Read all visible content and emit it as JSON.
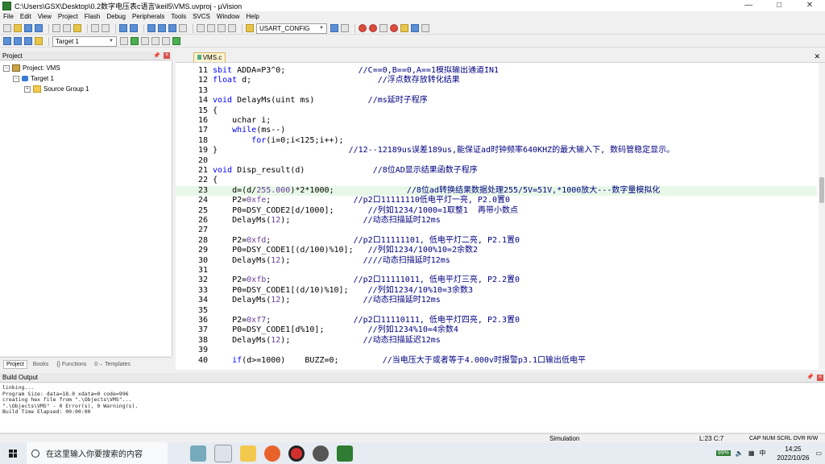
{
  "window": {
    "title": "C:\\Users\\GSX\\Desktop\\0.2数字电压表c语言\\keil5\\VMS.uvproj - µVision",
    "controls": [
      "—",
      "□",
      "✕"
    ]
  },
  "menu": [
    "File",
    "Edit",
    "View",
    "Project",
    "Flash",
    "Debug",
    "Peripherals",
    "Tools",
    "SVCS",
    "Window",
    "Help"
  ],
  "toolbar": {
    "config_combo": "USART_CONFIG",
    "target_combo": "Target 1"
  },
  "project_pane": {
    "title": "Project",
    "items": [
      {
        "label": "Project: VMS"
      },
      {
        "label": "Target 1"
      },
      {
        "label": "Source Group 1"
      }
    ],
    "tabs": [
      "Project",
      "Books",
      "{} Functions",
      "0→ Templates"
    ]
  },
  "editor": {
    "tab": "VMS.c",
    "current_line": 23
  },
  "code_lines": [
    {
      "n": "11",
      "parts": [
        [
          "kw",
          "sbit"
        ],
        [
          "t",
          " ADDA=P3^0;               "
        ],
        [
          "cm",
          "//C==0,B==0,A==1模拟输出通道IN1"
        ]
      ]
    },
    {
      "n": "12",
      "parts": [
        [
          "kw",
          "float"
        ],
        [
          "t",
          " d;                          "
        ],
        [
          "cm",
          "//浮点数存放转化结果"
        ]
      ]
    },
    {
      "n": "13",
      "parts": [
        [
          "t",
          ""
        ]
      ]
    },
    {
      "n": "14",
      "parts": [
        [
          "kw",
          "void"
        ],
        [
          "t",
          " DelayMs(uint ms)           "
        ],
        [
          "cm",
          "//ms延时子程序"
        ]
      ]
    },
    {
      "n": "15",
      "parts": [
        [
          "t",
          "{"
        ]
      ]
    },
    {
      "n": "16",
      "parts": [
        [
          "t",
          "    uchar i;"
        ]
      ]
    },
    {
      "n": "17",
      "parts": [
        [
          "t",
          "    "
        ],
        [
          "kw",
          "while"
        ],
        [
          "t",
          "(ms--)"
        ]
      ]
    },
    {
      "n": "18",
      "parts": [
        [
          "t",
          "        "
        ],
        [
          "kw",
          "for"
        ],
        [
          "t",
          "(i=0;i<125;i++);"
        ]
      ]
    },
    {
      "n": "19",
      "parts": [
        [
          "t",
          "}                           "
        ],
        [
          "cm",
          "//12--12189us误差189us,能保证ad时钟频率640KHZ的最大输入下, 数码管稳定显示。"
        ]
      ]
    },
    {
      "n": "20",
      "parts": [
        [
          "t",
          ""
        ]
      ]
    },
    {
      "n": "21",
      "parts": [
        [
          "kw",
          "void"
        ],
        [
          "t",
          " Disp_result(d)              "
        ],
        [
          "cm",
          "//8位AD显示结果函数子程序"
        ]
      ]
    },
    {
      "n": "22",
      "parts": [
        [
          "t",
          "{"
        ]
      ]
    },
    {
      "n": "23",
      "parts": [
        [
          "t",
          "    d=(d/"
        ],
        [
          "num",
          "255.000"
        ],
        [
          "t",
          ")*2*1000;               "
        ],
        [
          "cm",
          "//8位ad转换结果数据处理255/5V=51V,*1000放大---数字量模拟化"
        ]
      ]
    },
    {
      "n": "24",
      "parts": [
        [
          "t",
          "    P2="
        ],
        [
          "num",
          "0xfe"
        ],
        [
          "t",
          ";                 "
        ],
        [
          "cm",
          "//p2口11111110低电平灯一亮, P2.0置0"
        ]
      ]
    },
    {
      "n": "25",
      "parts": [
        [
          "t",
          "    P0=DSY_CODE2[d/1000];       "
        ],
        [
          "cm",
          "//列如1234/1000=1取整1  再带小数点"
        ]
      ]
    },
    {
      "n": "26",
      "parts": [
        [
          "t",
          "    DelayMs("
        ],
        [
          "num",
          "12"
        ],
        [
          "t",
          ");               "
        ],
        [
          "cm",
          "//动态扫描延时12ms"
        ]
      ]
    },
    {
      "n": "27",
      "parts": [
        [
          "t",
          ""
        ]
      ]
    },
    {
      "n": "28",
      "parts": [
        [
          "t",
          "    P2="
        ],
        [
          "num",
          "0xfd"
        ],
        [
          "t",
          ";                 "
        ],
        [
          "cm",
          "//p2口11111101, 低电平灯二亮, P2.1置0"
        ]
      ]
    },
    {
      "n": "29",
      "parts": [
        [
          "t",
          "    P0=DSY_CODE1[(d/100)%10];   "
        ],
        [
          "cm",
          "//列如1234/100%10=2余数2"
        ]
      ]
    },
    {
      "n": "30",
      "parts": [
        [
          "t",
          "    DelayMs("
        ],
        [
          "num",
          "12"
        ],
        [
          "t",
          ");               "
        ],
        [
          "cm",
          "////动态扫描延时12ms"
        ]
      ]
    },
    {
      "n": "31",
      "parts": [
        [
          "t",
          ""
        ]
      ]
    },
    {
      "n": "32",
      "parts": [
        [
          "t",
          "    P2="
        ],
        [
          "num",
          "0xfb"
        ],
        [
          "t",
          ";                 "
        ],
        [
          "cm",
          "//p2口11111011, 低电平灯三亮, P2.2置0"
        ]
      ]
    },
    {
      "n": "33",
      "parts": [
        [
          "t",
          "    P0=DSY_CODE1[(d/10)%10];    "
        ],
        [
          "cm",
          "//列如1234/10%10=3余数3"
        ]
      ]
    },
    {
      "n": "34",
      "parts": [
        [
          "t",
          "    DelayMs("
        ],
        [
          "num",
          "12"
        ],
        [
          "t",
          ");               "
        ],
        [
          "cm",
          "//动态扫描延时12ms"
        ]
      ]
    },
    {
      "n": "35",
      "parts": [
        [
          "t",
          ""
        ]
      ]
    },
    {
      "n": "36",
      "parts": [
        [
          "t",
          "    P2="
        ],
        [
          "num",
          "0xf7"
        ],
        [
          "t",
          ";                 "
        ],
        [
          "cm",
          "//p2口11110111, 低电平灯四亮, P2.3置0"
        ]
      ]
    },
    {
      "n": "37",
      "parts": [
        [
          "t",
          "    P0=DSY_CODE1[d%10];         "
        ],
        [
          "cm",
          "//列如1234%10=4余数4"
        ]
      ]
    },
    {
      "n": "38",
      "parts": [
        [
          "t",
          "    DelayMs("
        ],
        [
          "num",
          "12"
        ],
        [
          "t",
          ");               "
        ],
        [
          "cm",
          "//动态扫描延迟12ms"
        ]
      ]
    },
    {
      "n": "39",
      "parts": [
        [
          "t",
          ""
        ]
      ]
    },
    {
      "n": "40",
      "parts": [
        [
          "t",
          "    "
        ],
        [
          "kw",
          "if"
        ],
        [
          "t",
          "(d>=1000)    BUZZ=0;         "
        ],
        [
          "cm",
          "//当电压大于或者等于4.000v时报警p3.1口输出低电平"
        ]
      ]
    }
  ],
  "build_output": {
    "title": "Build Output",
    "lines": [
      "linking...",
      "Program Size: data=18.0 xdata=0 code=996",
      "creating hex file from \".\\Objects\\VMS\"...",
      "\".\\Objects\\VMS\" - 0 Error(s), 0 Warning(s).",
      "Build Time Elapsed:  00:00:00"
    ]
  },
  "status": {
    "mode": "Simulation",
    "position": "L:23 C:7",
    "indicators": "CAP  NUM  SCRL  OVR  R/W"
  },
  "taskbar": {
    "search_placeholder": "在这里输入你要搜索的内容",
    "time": "14:25",
    "date": "2022/10/26",
    "battery": "99%",
    "lang": "中"
  },
  "colors": {
    "keyword": "#0000ff",
    "comment": "#000080",
    "number": "#6a3d9a",
    "current_line": "#e8f8e8"
  }
}
